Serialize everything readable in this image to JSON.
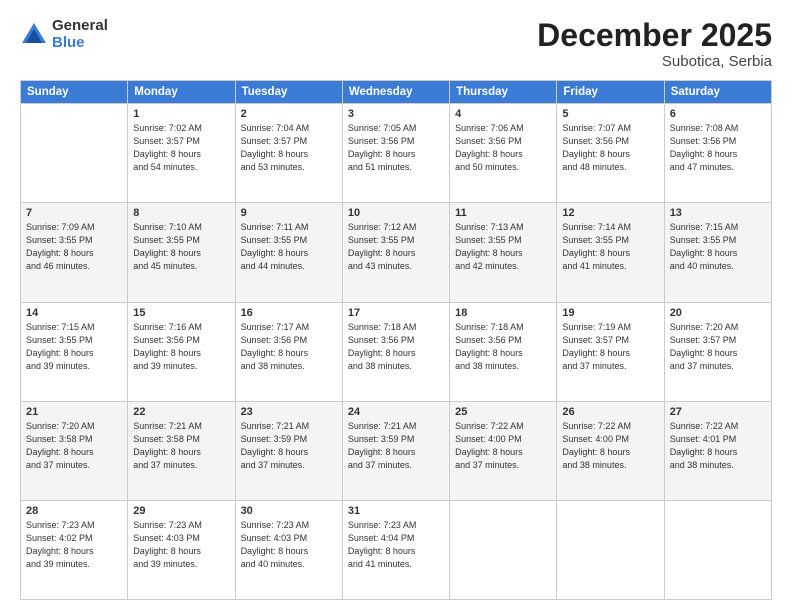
{
  "logo": {
    "general": "General",
    "blue": "Blue"
  },
  "header": {
    "month": "December 2025",
    "location": "Subotica, Serbia"
  },
  "weekdays": [
    "Sunday",
    "Monday",
    "Tuesday",
    "Wednesday",
    "Thursday",
    "Friday",
    "Saturday"
  ],
  "weeks": [
    [
      {
        "day": "",
        "info": ""
      },
      {
        "day": "1",
        "info": "Sunrise: 7:02 AM\nSunset: 3:57 PM\nDaylight: 8 hours\nand 54 minutes."
      },
      {
        "day": "2",
        "info": "Sunrise: 7:04 AM\nSunset: 3:57 PM\nDaylight: 8 hours\nand 53 minutes."
      },
      {
        "day": "3",
        "info": "Sunrise: 7:05 AM\nSunset: 3:56 PM\nDaylight: 8 hours\nand 51 minutes."
      },
      {
        "day": "4",
        "info": "Sunrise: 7:06 AM\nSunset: 3:56 PM\nDaylight: 8 hours\nand 50 minutes."
      },
      {
        "day": "5",
        "info": "Sunrise: 7:07 AM\nSunset: 3:56 PM\nDaylight: 8 hours\nand 48 minutes."
      },
      {
        "day": "6",
        "info": "Sunrise: 7:08 AM\nSunset: 3:56 PM\nDaylight: 8 hours\nand 47 minutes."
      }
    ],
    [
      {
        "day": "7",
        "info": "Sunrise: 7:09 AM\nSunset: 3:55 PM\nDaylight: 8 hours\nand 46 minutes."
      },
      {
        "day": "8",
        "info": "Sunrise: 7:10 AM\nSunset: 3:55 PM\nDaylight: 8 hours\nand 45 minutes."
      },
      {
        "day": "9",
        "info": "Sunrise: 7:11 AM\nSunset: 3:55 PM\nDaylight: 8 hours\nand 44 minutes."
      },
      {
        "day": "10",
        "info": "Sunrise: 7:12 AM\nSunset: 3:55 PM\nDaylight: 8 hours\nand 43 minutes."
      },
      {
        "day": "11",
        "info": "Sunrise: 7:13 AM\nSunset: 3:55 PM\nDaylight: 8 hours\nand 42 minutes."
      },
      {
        "day": "12",
        "info": "Sunrise: 7:14 AM\nSunset: 3:55 PM\nDaylight: 8 hours\nand 41 minutes."
      },
      {
        "day": "13",
        "info": "Sunrise: 7:15 AM\nSunset: 3:55 PM\nDaylight: 8 hours\nand 40 minutes."
      }
    ],
    [
      {
        "day": "14",
        "info": "Sunrise: 7:15 AM\nSunset: 3:55 PM\nDaylight: 8 hours\nand 39 minutes."
      },
      {
        "day": "15",
        "info": "Sunrise: 7:16 AM\nSunset: 3:56 PM\nDaylight: 8 hours\nand 39 minutes."
      },
      {
        "day": "16",
        "info": "Sunrise: 7:17 AM\nSunset: 3:56 PM\nDaylight: 8 hours\nand 38 minutes."
      },
      {
        "day": "17",
        "info": "Sunrise: 7:18 AM\nSunset: 3:56 PM\nDaylight: 8 hours\nand 38 minutes."
      },
      {
        "day": "18",
        "info": "Sunrise: 7:18 AM\nSunset: 3:56 PM\nDaylight: 8 hours\nand 38 minutes."
      },
      {
        "day": "19",
        "info": "Sunrise: 7:19 AM\nSunset: 3:57 PM\nDaylight: 8 hours\nand 37 minutes."
      },
      {
        "day": "20",
        "info": "Sunrise: 7:20 AM\nSunset: 3:57 PM\nDaylight: 8 hours\nand 37 minutes."
      }
    ],
    [
      {
        "day": "21",
        "info": "Sunrise: 7:20 AM\nSunset: 3:58 PM\nDaylight: 8 hours\nand 37 minutes."
      },
      {
        "day": "22",
        "info": "Sunrise: 7:21 AM\nSunset: 3:58 PM\nDaylight: 8 hours\nand 37 minutes."
      },
      {
        "day": "23",
        "info": "Sunrise: 7:21 AM\nSunset: 3:59 PM\nDaylight: 8 hours\nand 37 minutes."
      },
      {
        "day": "24",
        "info": "Sunrise: 7:21 AM\nSunset: 3:59 PM\nDaylight: 8 hours\nand 37 minutes."
      },
      {
        "day": "25",
        "info": "Sunrise: 7:22 AM\nSunset: 4:00 PM\nDaylight: 8 hours\nand 37 minutes."
      },
      {
        "day": "26",
        "info": "Sunrise: 7:22 AM\nSunset: 4:00 PM\nDaylight: 8 hours\nand 38 minutes."
      },
      {
        "day": "27",
        "info": "Sunrise: 7:22 AM\nSunset: 4:01 PM\nDaylight: 8 hours\nand 38 minutes."
      }
    ],
    [
      {
        "day": "28",
        "info": "Sunrise: 7:23 AM\nSunset: 4:02 PM\nDaylight: 8 hours\nand 39 minutes."
      },
      {
        "day": "29",
        "info": "Sunrise: 7:23 AM\nSunset: 4:03 PM\nDaylight: 8 hours\nand 39 minutes."
      },
      {
        "day": "30",
        "info": "Sunrise: 7:23 AM\nSunset: 4:03 PM\nDaylight: 8 hours\nand 40 minutes."
      },
      {
        "day": "31",
        "info": "Sunrise: 7:23 AM\nSunset: 4:04 PM\nDaylight: 8 hours\nand 41 minutes."
      },
      {
        "day": "",
        "info": ""
      },
      {
        "day": "",
        "info": ""
      },
      {
        "day": "",
        "info": ""
      }
    ]
  ]
}
